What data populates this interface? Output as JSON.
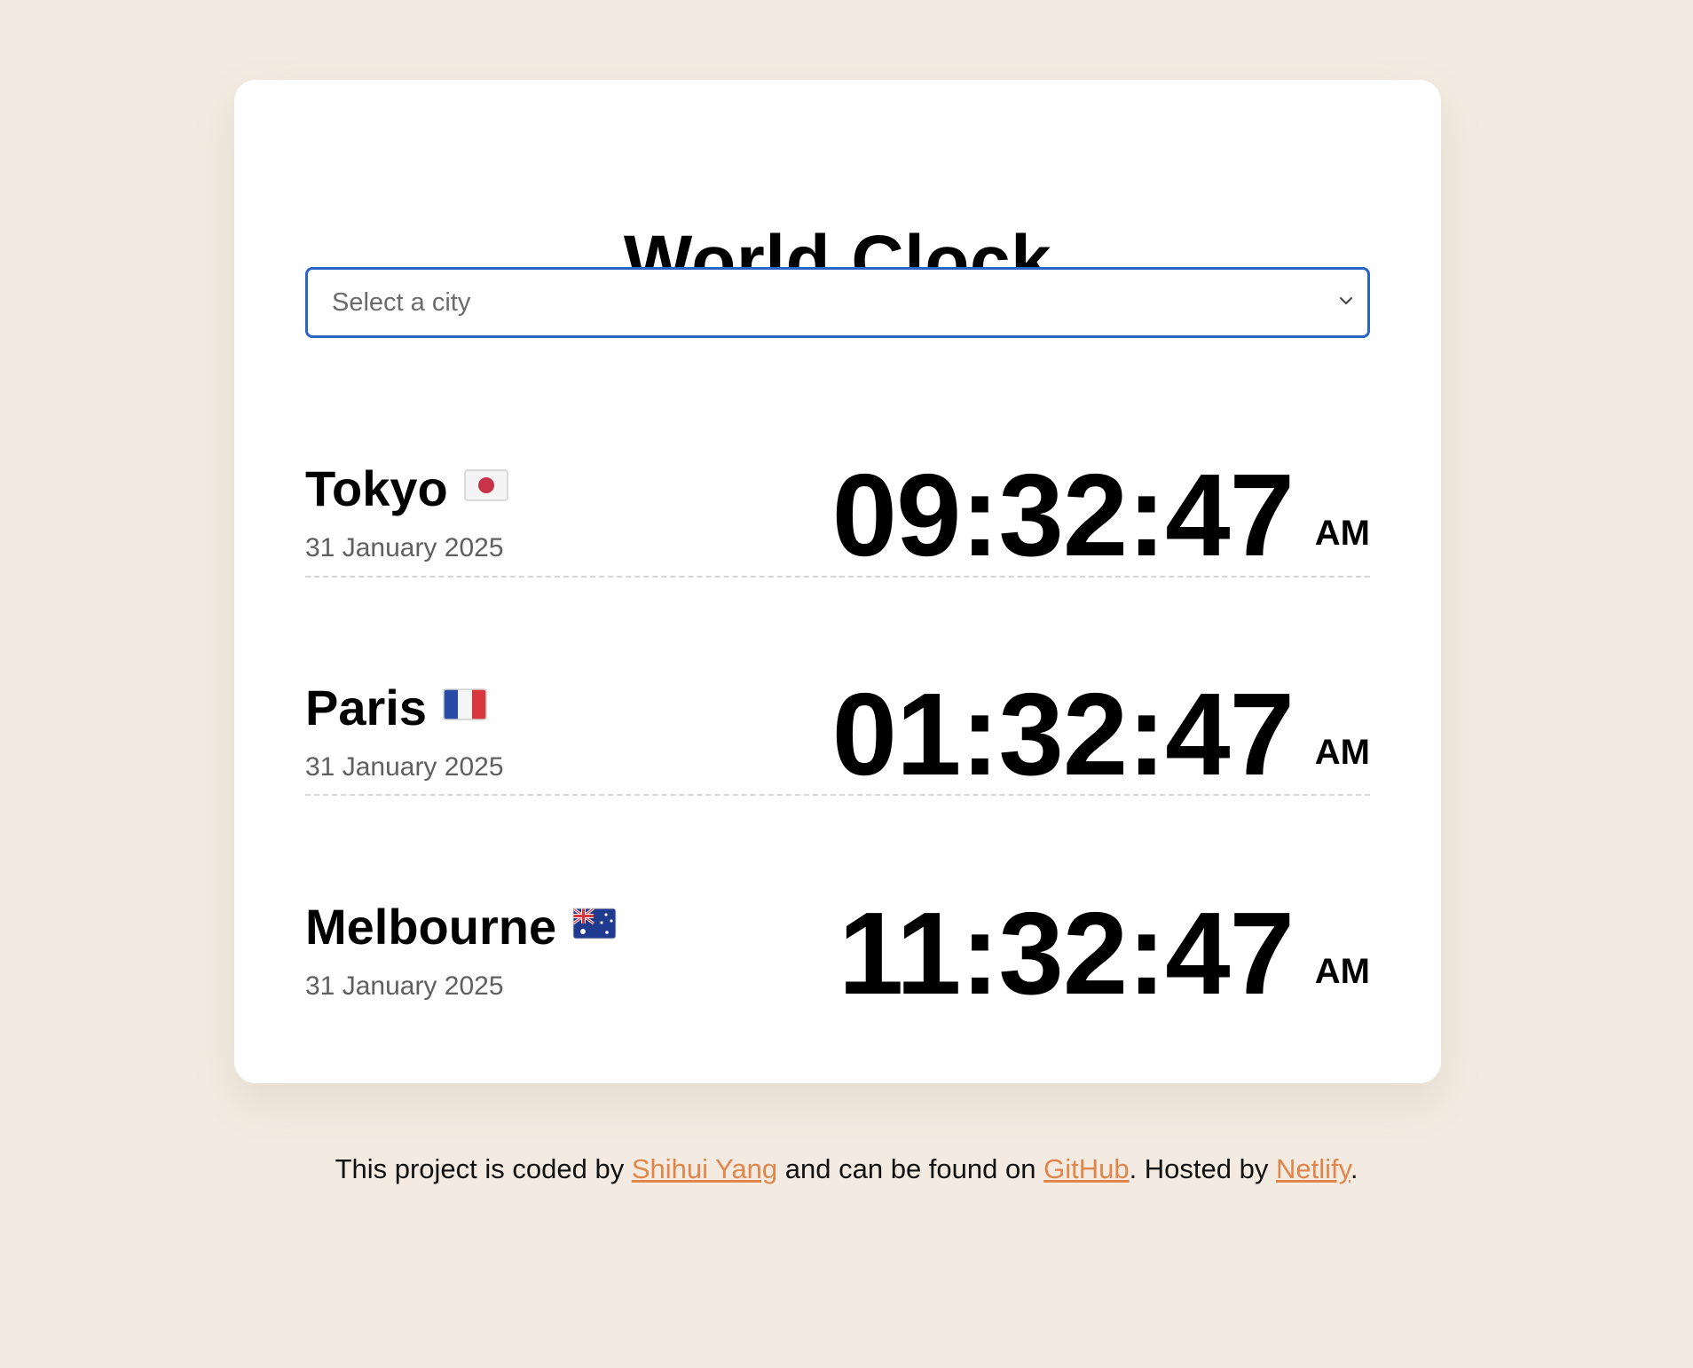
{
  "app": {
    "title": "World Clock"
  },
  "city_select": {
    "selected_label": "Select a city",
    "focus_color": "#2a64c7"
  },
  "cities": [
    {
      "name": "Tokyo",
      "flag": "japan-flag-icon",
      "date": "31 January 2025",
      "time": "09:32:47",
      "ampm": "AM"
    },
    {
      "name": "Paris",
      "flag": "france-flag-icon",
      "date": "31 January 2025",
      "time": "01:32:47",
      "ampm": "AM"
    },
    {
      "name": "Melbourne",
      "flag": "australia-flag-icon",
      "date": "31 January 2025",
      "time": "11:32:47",
      "ampm": "AM"
    }
  ],
  "footer": {
    "text_1": "This project is coded by ",
    "author_link": "Shihui Yang",
    "text_2": " and can be found on ",
    "github_link": "GitHub",
    "text_3": ". Hosted by ",
    "host_link": "Netlify",
    "text_4": ".",
    "link_color": "#e0864a"
  },
  "colors": {
    "background": "#f3ebe1",
    "card": "#ffffff"
  }
}
